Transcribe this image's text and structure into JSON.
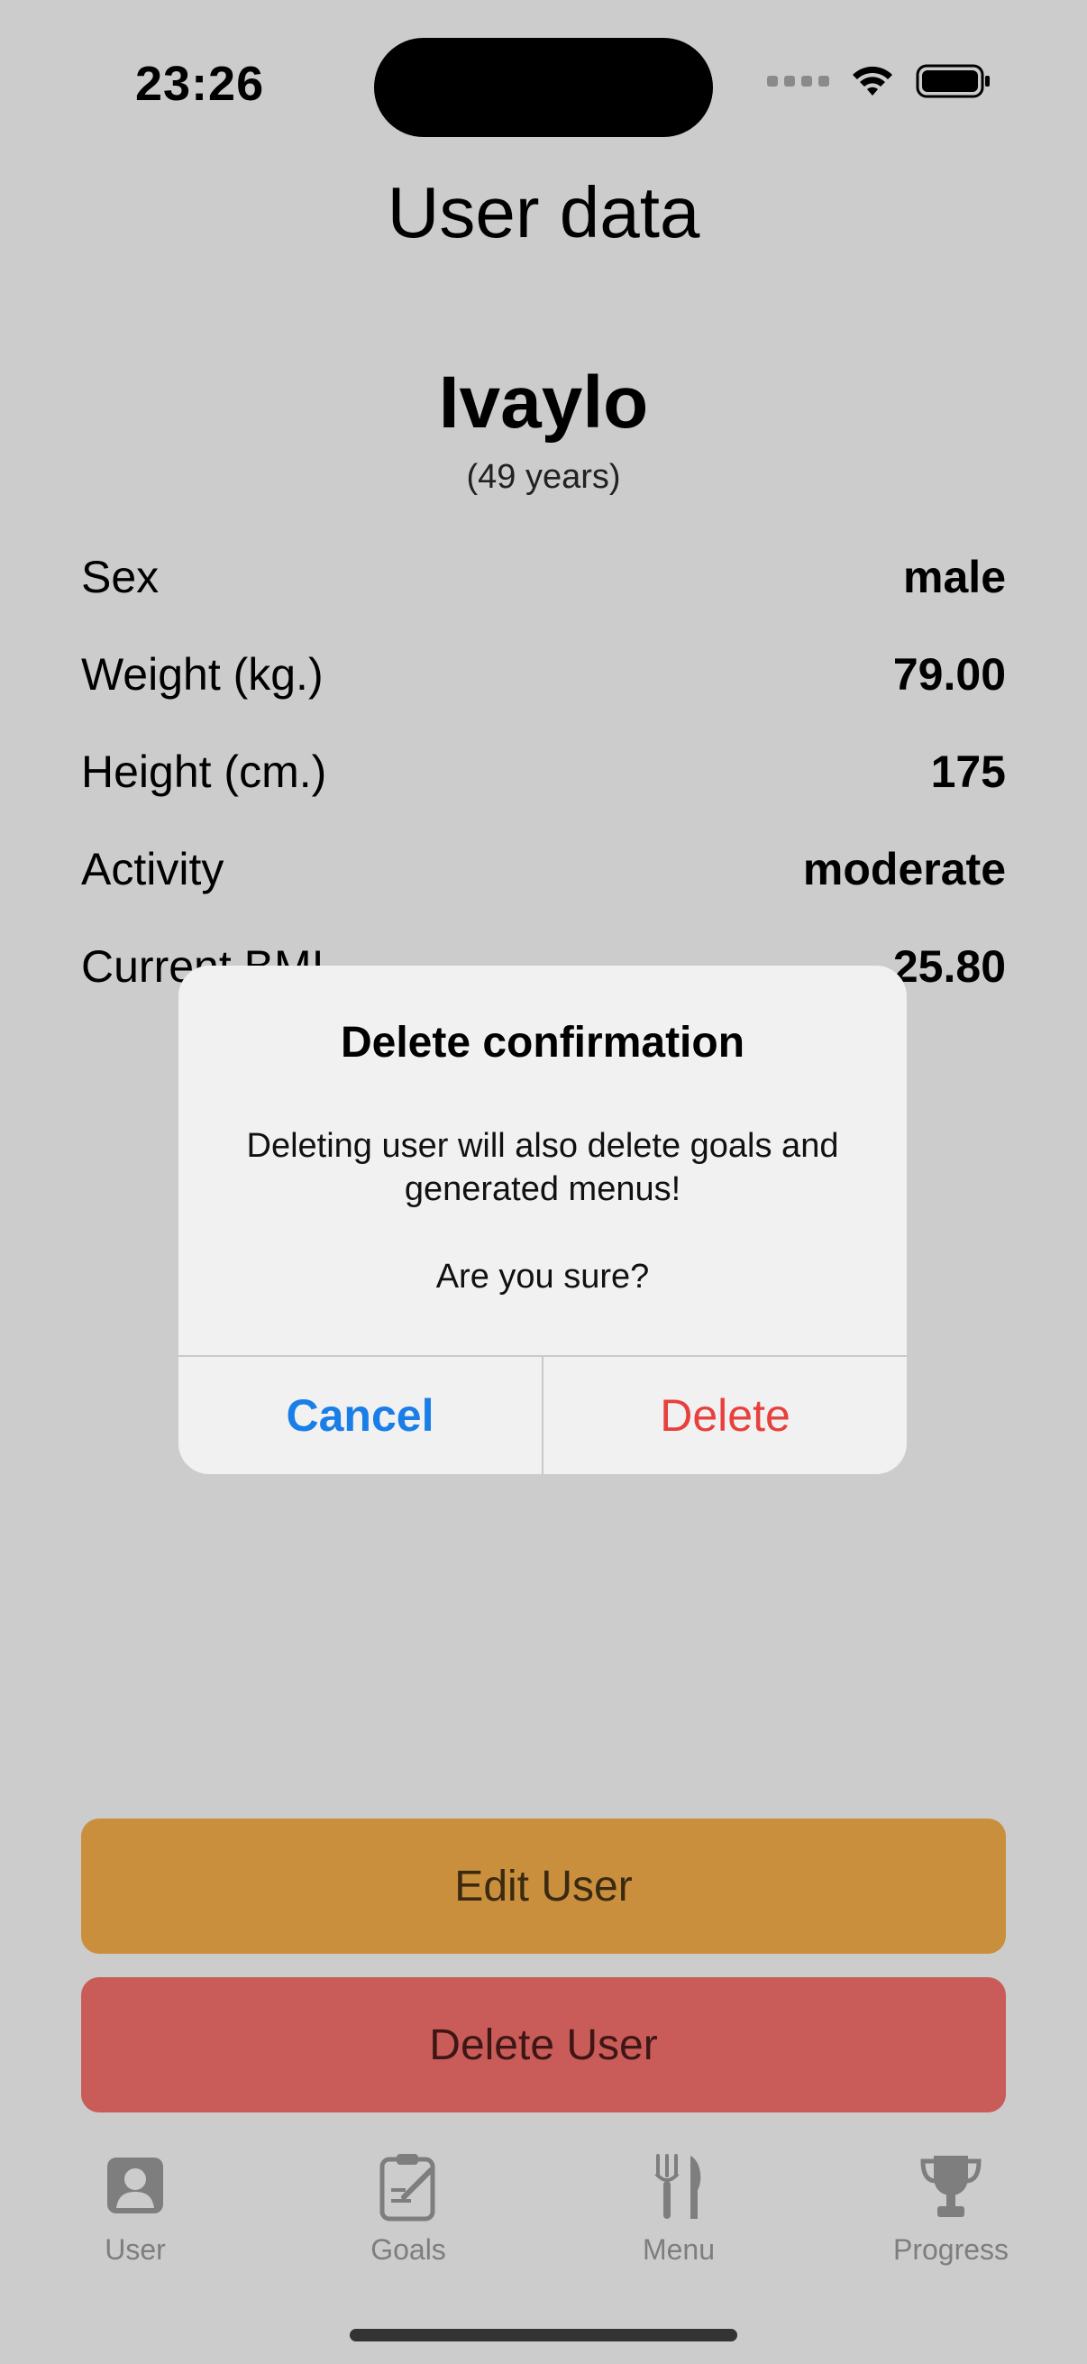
{
  "status_bar": {
    "time": "23:26"
  },
  "nav": {
    "title": "User data"
  },
  "user": {
    "name": "Ivaylo",
    "age": "(49 years)"
  },
  "details": [
    {
      "label": "Sex",
      "value": "male"
    },
    {
      "label": "Weight (kg.)",
      "value": "79.00"
    },
    {
      "label": "Height (cm.)",
      "value": "175"
    },
    {
      "label": "Activity",
      "value": "moderate"
    },
    {
      "label": "Current BMI",
      "value": "25.80"
    }
  ],
  "buttons": {
    "edit": "Edit User",
    "delete": "Delete User"
  },
  "alert": {
    "title": "Delete confirmation",
    "message": "Deleting user will also delete goals and generated menus!",
    "question": "Are you sure?",
    "cancel": "Cancel",
    "confirm": "Delete"
  },
  "tabs": [
    {
      "label": "User",
      "icon": "person-icon"
    },
    {
      "label": "Goals",
      "icon": "clipboard-icon"
    },
    {
      "label": "Menu",
      "icon": "fork-knife-icon"
    },
    {
      "label": "Progress",
      "icon": "trophy-icon"
    }
  ],
  "colors": {
    "background": "#cccccc",
    "edit_button": "#c98f3d",
    "delete_button": "#c95c58",
    "alert_cancel": "#1a7ee8",
    "alert_delete": "#e8403c"
  }
}
